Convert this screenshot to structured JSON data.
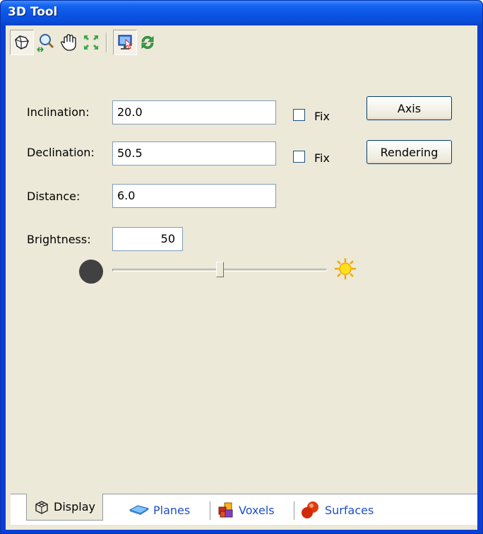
{
  "window": {
    "title": "3D Tool"
  },
  "toolbar": {
    "buttons": [
      {
        "icon": "rotate-view-icon",
        "pressed": true
      },
      {
        "icon": "zoom-icon",
        "pressed": false
      },
      {
        "icon": "pan-hand-icon",
        "pressed": false
      },
      {
        "icon": "fit-view-icon",
        "pressed": false
      },
      {
        "icon": "screen-capture-icon",
        "pressed": true
      },
      {
        "icon": "refresh-icon",
        "pressed": false
      }
    ]
  },
  "form": {
    "inclination": {
      "label": "Inclination:",
      "value": "20.0",
      "fix_label": "Fix",
      "fix_checked": false
    },
    "declination": {
      "label": "Declination:",
      "value": "50.5",
      "fix_label": "Fix",
      "fix_checked": false
    },
    "distance": {
      "label": "Distance:",
      "value": "6.0"
    },
    "brightness": {
      "label": "Brightness:",
      "value": "50",
      "slider_fraction": 0.5
    }
  },
  "buttons": {
    "axis": "Axis",
    "rendering": "Rendering"
  },
  "tabs": [
    {
      "label": "Display",
      "icon": "cube-wireframe-icon",
      "active": true
    },
    {
      "label": "Planes",
      "icon": "plane-icon",
      "active": false
    },
    {
      "label": "Voxels",
      "icon": "voxels-icon",
      "active": false
    },
    {
      "label": "Surfaces",
      "icon": "surface-blob-icon",
      "active": false
    }
  ],
  "colors": {
    "titlebar": "#0a54e6",
    "client_bg": "#ece9d8",
    "field_border": "#7f9db9",
    "tab_text": "#1f4fc5"
  }
}
